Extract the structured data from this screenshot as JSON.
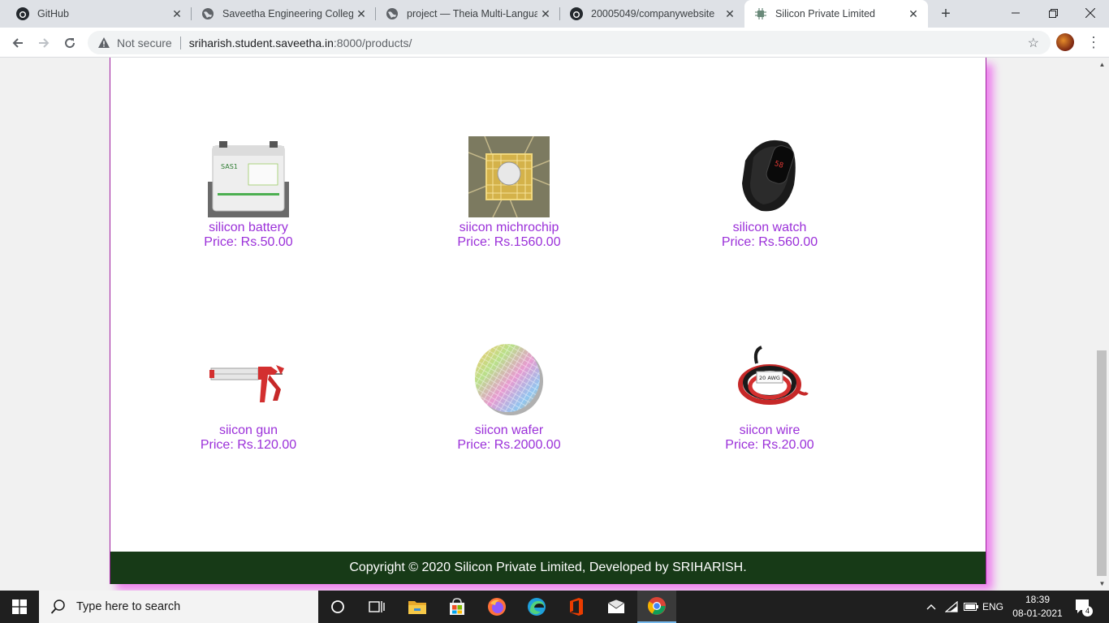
{
  "browser": {
    "tabs": [
      {
        "title": "GitHub",
        "icon": "github-icon"
      },
      {
        "title": "Saveetha Engineering College",
        "icon": "globe-icon"
      },
      {
        "title": "project — Theia Multi-Languag",
        "icon": "globe-icon"
      },
      {
        "title": "20005049/companywebsite",
        "icon": "github-icon"
      },
      {
        "title": "Silicon Private Limited",
        "icon": "chip-icon"
      }
    ],
    "security_label": "Not secure",
    "url_host": "sriharish.student.saveetha.in",
    "url_rest": ":8000/products/"
  },
  "products": [
    {
      "name": "silicon battery",
      "price": "Price: Rs.50.00",
      "image": "battery"
    },
    {
      "name": "siicon michrochip",
      "price": "Price: Rs.1560.00",
      "image": "microchip"
    },
    {
      "name": "silicon watch",
      "price": "Price: Rs.560.00",
      "image": "watch"
    },
    {
      "name": "siicon gun",
      "price": "Price: Rs.120.00",
      "image": "gun"
    },
    {
      "name": "siicon wafer",
      "price": "Price: Rs.2000.00",
      "image": "wafer"
    },
    {
      "name": "siicon wire",
      "price": "Price: Rs.20.00",
      "image": "wire"
    }
  ],
  "image_labels": {
    "battery_brand": "SAS1",
    "wire_gauge": "20 AWG"
  },
  "footer": {
    "text": "Copyright © 2020 Silicon Private Limited, Developed by SRIHARISH."
  },
  "taskbar": {
    "search_placeholder": "Type here to search",
    "language": "ENG",
    "time": "18:39",
    "date": "08-01-2021",
    "notification_count": "4"
  },
  "colors": {
    "accent": "#9b30d9",
    "footer_bg": "#173a17",
    "page_shadow": "#ee82ee"
  }
}
